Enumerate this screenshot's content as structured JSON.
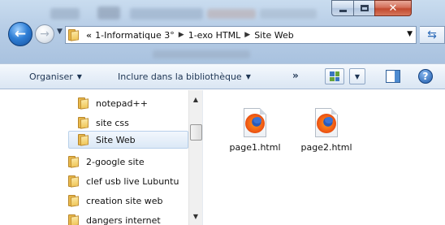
{
  "window": {
    "caption_min": "–",
    "caption_max": "□",
    "caption_close": "✕"
  },
  "nav": {
    "back": "←",
    "forward": "→"
  },
  "address": {
    "overflow": "«",
    "crumbs": [
      "1-Informatique 3°",
      "1-exo HTML",
      "Site Web"
    ]
  },
  "toolbar": {
    "organiser": "Organiser",
    "inclure": "Inclure dans la bibliothèque",
    "more": "»",
    "help": "?"
  },
  "tree": {
    "items": [
      {
        "label": "notepad++",
        "selected": false
      },
      {
        "label": "site css",
        "selected": false
      },
      {
        "label": "Site Web",
        "selected": true
      },
      {
        "label": "2-google site",
        "selected": false
      },
      {
        "label": "clef usb live Lubuntu",
        "selected": false
      },
      {
        "label": "creation site web",
        "selected": false
      },
      {
        "label": "dangers internet",
        "selected": false
      }
    ]
  },
  "files": [
    {
      "name": "page1.html",
      "icon": "firefox-html-icon"
    },
    {
      "name": "page2.html",
      "icon": "firefox-html-icon"
    }
  ]
}
